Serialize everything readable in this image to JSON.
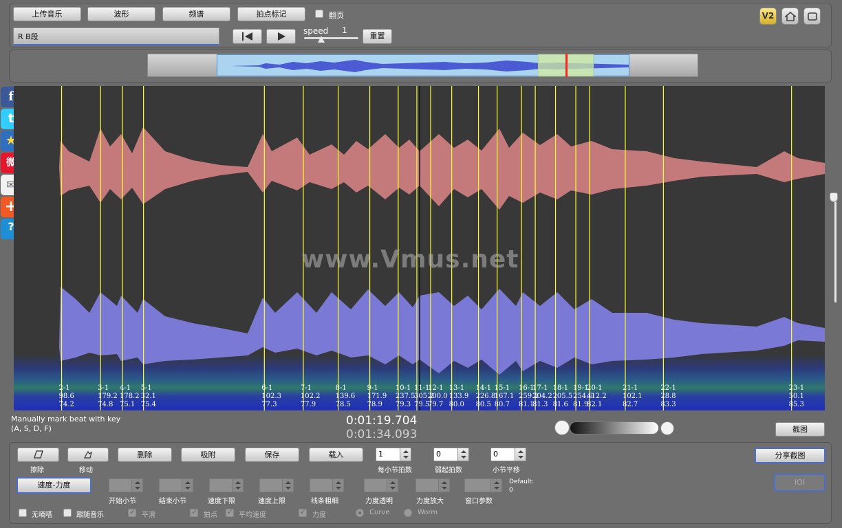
{
  "toolbar": {
    "upload_label": "上传音乐",
    "waveform_label": "波形",
    "spectrum_label": "频谱",
    "beat_label": "拍点标记",
    "flip_label": "翻页",
    "track_name": "R B段",
    "speed_label": "speed",
    "speed_value": "1",
    "reset_label": "重置",
    "v2_label": "V2"
  },
  "watermark": "www.Vmus.net",
  "beats": [
    {
      "label": "2-1",
      "bpm": "98.6",
      "vel": "74.2",
      "pos": 0.059
    },
    {
      "label": "3-1",
      "bpm": "179.2",
      "vel": "74.8",
      "pos": 0.107
    },
    {
      "label": "4-1",
      "bpm": "178.2",
      "vel": "75.1",
      "pos": 0.134
    },
    {
      "label": "5-1",
      "bpm": "32.1",
      "vel": "75.4",
      "pos": 0.16
    },
    {
      "label": "6-1",
      "bpm": "102.3",
      "vel": "77.3",
      "pos": 0.309
    },
    {
      "label": "7-1",
      "bpm": "102.2",
      "vel": "77.9",
      "pos": 0.357
    },
    {
      "label": "8-1",
      "bpm": "139.6",
      "vel": "78.5",
      "pos": 0.4
    },
    {
      "label": "9-1",
      "bpm": "171.9",
      "vel": "78.9",
      "pos": 0.439
    },
    {
      "label": "10-1",
      "bpm": "237.5",
      "vel": "79.3",
      "pos": 0.474
    },
    {
      "label": "11-1",
      "bpm": "305.2",
      "vel": "79.5",
      "pos": 0.497
    },
    {
      "label": "12-1",
      "bpm": "200.0",
      "vel": "79.7",
      "pos": 0.514
    },
    {
      "label": "13-1",
      "bpm": "133.9",
      "vel": "80.0",
      "pos": 0.54
    },
    {
      "label": "14-1",
      "bpm": "226.8",
      "vel": "80.5",
      "pos": 0.573
    },
    {
      "label": "15-1",
      "bpm": "167.1",
      "vel": "80.7",
      "pos": 0.596
    },
    {
      "label": "16-1",
      "bpm": "259.2",
      "vel": "81.1",
      "pos": 0.626
    },
    {
      "label": "17-1",
      "bpm": "204.2",
      "vel": "81.3",
      "pos": 0.643
    },
    {
      "label": "18-1",
      "bpm": "205.5",
      "vel": "81.6",
      "pos": 0.668
    },
    {
      "label": "19-1",
      "bpm": "254.6",
      "vel": "81.9",
      "pos": 0.693
    },
    {
      "label": "20-1",
      "bpm": "412.2",
      "vel": "82.1",
      "pos": 0.71
    },
    {
      "label": "21-1",
      "bpm": "102.1",
      "vel": "82.7",
      "pos": 0.754
    },
    {
      "label": "22-1",
      "bpm": "28.8",
      "vel": "83.3",
      "pos": 0.801
    },
    {
      "label": "23-1",
      "bpm": "50.1",
      "vel": "85.3",
      "pos": 0.959
    }
  ],
  "status": {
    "hint_line1": "Manually mark beat with key",
    "hint_line2": "(A, S, D, F)",
    "time_current": "0:01:19.704",
    "time_total": "0:01:34.093",
    "screenshot_label": "截图"
  },
  "controls": {
    "erase_label": "擦除",
    "move_label": "移动",
    "delete_label": "删除",
    "snap_label": "吸附",
    "save_label": "保存",
    "load_label": "载入",
    "beats_per_bar": {
      "value": "1",
      "label": "每小节拍数"
    },
    "pickup_beats": {
      "value": "0",
      "label": "弱起拍数"
    },
    "bar_offset": {
      "value": "0",
      "label": "小节平移"
    },
    "share_label": "分享截图",
    "ioi_label": "IOI",
    "tempo_velocity_label": "速度-力度",
    "start_bar_label": "开始小节",
    "end_bar_label": "结束小节",
    "tempo_lower_label": "速度下限",
    "tempo_upper_label": "速度上限",
    "line_width_label": "线条粗细",
    "vel_alpha_label": "力度透明",
    "vel_zoom_label": "力度放大",
    "window_param_label": "窗口参数",
    "default_label": "Default:",
    "default_value": "0",
    "metronome_label": "无嘀嗒",
    "follow_label": "跟随音乐",
    "smooth_label": "平滑",
    "beat_pt_label": "拍点",
    "avg_speed_label": "平均速度",
    "velocity_label": "力度",
    "curve_label": "Curve",
    "worm_label": "Worm"
  },
  "colors": {
    "accent_blue": "#4a6fd0",
    "beat_line": "#ffff33",
    "upper_wave": "#c47a7a",
    "lower_wave": "#7b79d6",
    "playhead": "#ff2222"
  }
}
